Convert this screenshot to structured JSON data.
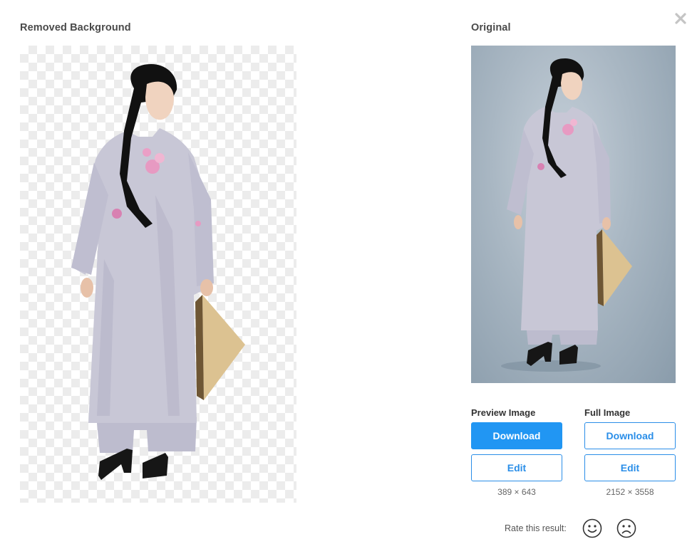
{
  "panels": {
    "removed_heading": "Removed Background",
    "original_heading": "Original"
  },
  "icons": {
    "close": "close-icon",
    "smile": "smile-face-icon",
    "frown": "frown-face-icon"
  },
  "preview": {
    "label": "Preview Image",
    "download_label": "Download",
    "edit_label": "Edit",
    "dimensions": "389 × 643"
  },
  "full": {
    "label": "Full Image",
    "download_label": "Download",
    "edit_label": "Edit",
    "dimensions": "2152 × 3558"
  },
  "rating": {
    "label": "Rate this result:"
  },
  "colors": {
    "accent": "#2196f3",
    "dress": "#c7c6d6",
    "hair": "#111111",
    "hat": "#d9be8c",
    "studio_bg": "#a9b7c3",
    "checker": "#ececec"
  }
}
